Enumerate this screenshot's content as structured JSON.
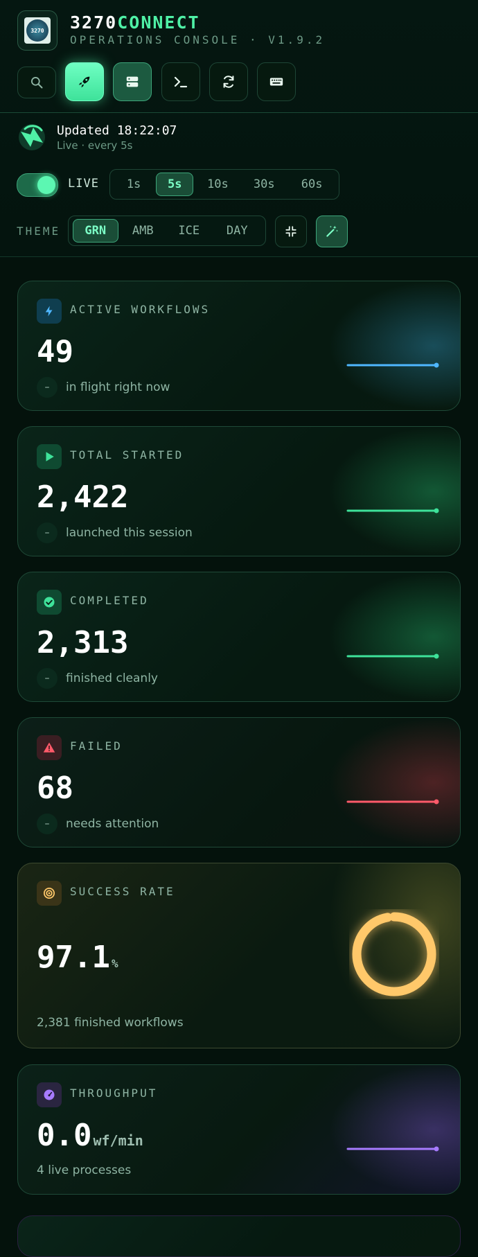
{
  "app": {
    "name_part1": "3270",
    "name_part2": "CONNECT",
    "subtitle": "OPERATIONS CONSOLE · V1.9.2",
    "logo_text": "3270"
  },
  "toolbar": [
    {
      "name": "search",
      "icon": "search-icon"
    },
    {
      "name": "launch",
      "icon": "rocket-icon"
    },
    {
      "name": "servers",
      "icon": "server-icon"
    },
    {
      "name": "terminal",
      "icon": "terminal-icon"
    },
    {
      "name": "refresh",
      "icon": "refresh-icon"
    },
    {
      "name": "keyboard",
      "icon": "keyboard-icon"
    }
  ],
  "status": {
    "updated": "Updated 18:22:07",
    "live_every": "Live · every 5s"
  },
  "live_toggle": {
    "label": "LIVE",
    "on": true
  },
  "intervals": {
    "options": [
      "1s",
      "5s",
      "10s",
      "30s",
      "60s"
    ],
    "selected": "5s"
  },
  "theme": {
    "label": "THEME",
    "options": [
      "GRN",
      "AMB",
      "ICE",
      "DAY"
    ],
    "selected": "GRN"
  },
  "colors": {
    "accent": "#4ff0a6",
    "background": "#04120c",
    "blue": "#4fb7ff",
    "green": "#3ee29a",
    "red": "#ff5a6a",
    "amber": "#ffc86a",
    "purple": "#a77bff"
  },
  "cards": {
    "active": {
      "label": "ACTIVE WORKFLOWS",
      "value": "49",
      "delta": "–",
      "sub": "in flight right now",
      "icon": "bolt-icon"
    },
    "started": {
      "label": "TOTAL STARTED",
      "value": "2,422",
      "delta": "–",
      "sub": "launched this session",
      "icon": "play-icon"
    },
    "completed": {
      "label": "COMPLETED",
      "value": "2,313",
      "delta": "–",
      "sub": "finished cleanly",
      "icon": "check-circle-icon"
    },
    "failed": {
      "label": "FAILED",
      "value": "68",
      "delta": "–",
      "sub": "needs attention",
      "icon": "warning-icon"
    },
    "success": {
      "label": "SUCCESS RATE",
      "value": "97.1",
      "unit": "%",
      "sub": "2,381 finished workflows",
      "icon": "target-icon",
      "rate": 0.971
    },
    "throughput": {
      "label": "THROUGHPUT",
      "value": "0.0",
      "unit": "wf/min",
      "sub": "4 live processes",
      "icon": "gauge-icon"
    }
  }
}
